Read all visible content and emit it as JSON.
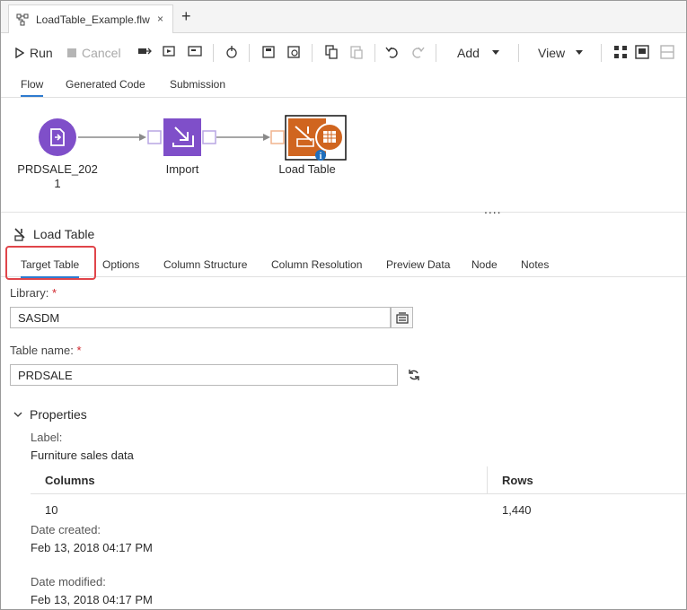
{
  "window": {
    "tab_title": "LoadTable_Example.flw",
    "close_symbol": "×",
    "new_tab_symbol": "+"
  },
  "toolbar": {
    "run_label": "Run",
    "cancel_label": "Cancel",
    "add_label": "Add",
    "view_label": "View"
  },
  "view_tabs": [
    "Flow",
    "Generated Code",
    "Submission"
  ],
  "flow": {
    "nodes": [
      {
        "label_line1": "PRDSALE_202",
        "label_line2": "1"
      },
      {
        "label_line1": "Import"
      },
      {
        "label_line1": "Load Table"
      }
    ],
    "colors": {
      "purple": "#7f4fc9",
      "orange": "#d0651f",
      "connector": "#8a8a8a"
    }
  },
  "panel": {
    "title": "Load Table",
    "tabs": [
      "Target Table",
      "Options",
      "Column Structure",
      "Column Resolution",
      "Preview Data",
      "Node",
      "Notes"
    ],
    "library_label": "Library:",
    "library_value": "SASDM",
    "table_label": "Table name:",
    "table_value": "PRDSALE",
    "required_mark": "*",
    "properties_label": "Properties",
    "label_label": "Label:",
    "label_value": "Furniture sales data",
    "columns_header": "Columns",
    "rows_header": "Rows",
    "columns_value": "10",
    "rows_value": "1,440",
    "date_created_label": "Date created:",
    "date_created_value": "Feb 13, 2018 04:17 PM",
    "date_modified_label": "Date modified:",
    "date_modified_value": "Feb 13, 2018 04:17 PM"
  },
  "accent_color": "#2e7bcf",
  "highlight_color": "#e0454a"
}
